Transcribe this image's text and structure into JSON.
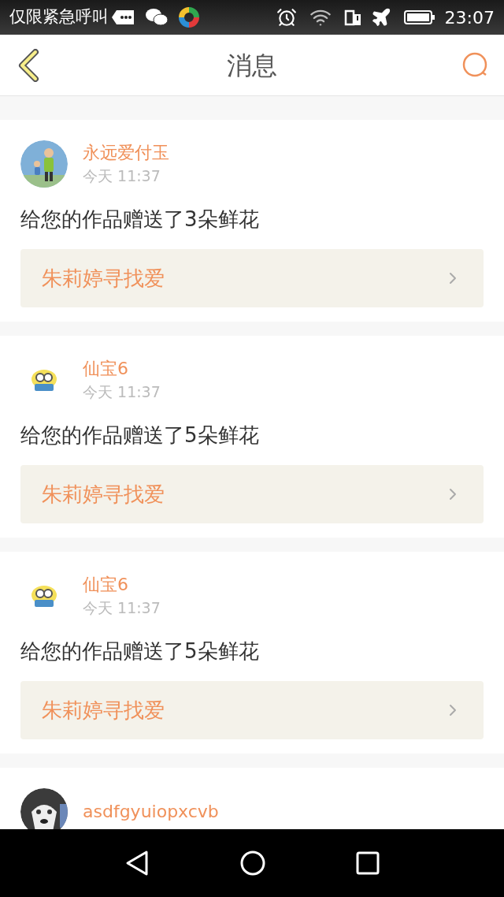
{
  "status_bar": {
    "carrier_text": "仅限紧急呼叫",
    "time": "23:07"
  },
  "header": {
    "title": "消息"
  },
  "messages": [
    {
      "name": "永远爱付玉",
      "time": "今天 11:37",
      "text": "给您的作品赠送了3朵鲜花",
      "link": "朱莉婷寻找爱"
    },
    {
      "name": "仙宝6",
      "time": "今天 11:37",
      "text": "给您的作品赠送了5朵鲜花",
      "link": "朱莉婷寻找爱"
    },
    {
      "name": "仙宝6",
      "time": "今天 11:37",
      "text": "给您的作品赠送了5朵鲜花",
      "link": "朱莉婷寻找爱"
    },
    {
      "name": "asdfgyuiopxcvb"
    }
  ]
}
